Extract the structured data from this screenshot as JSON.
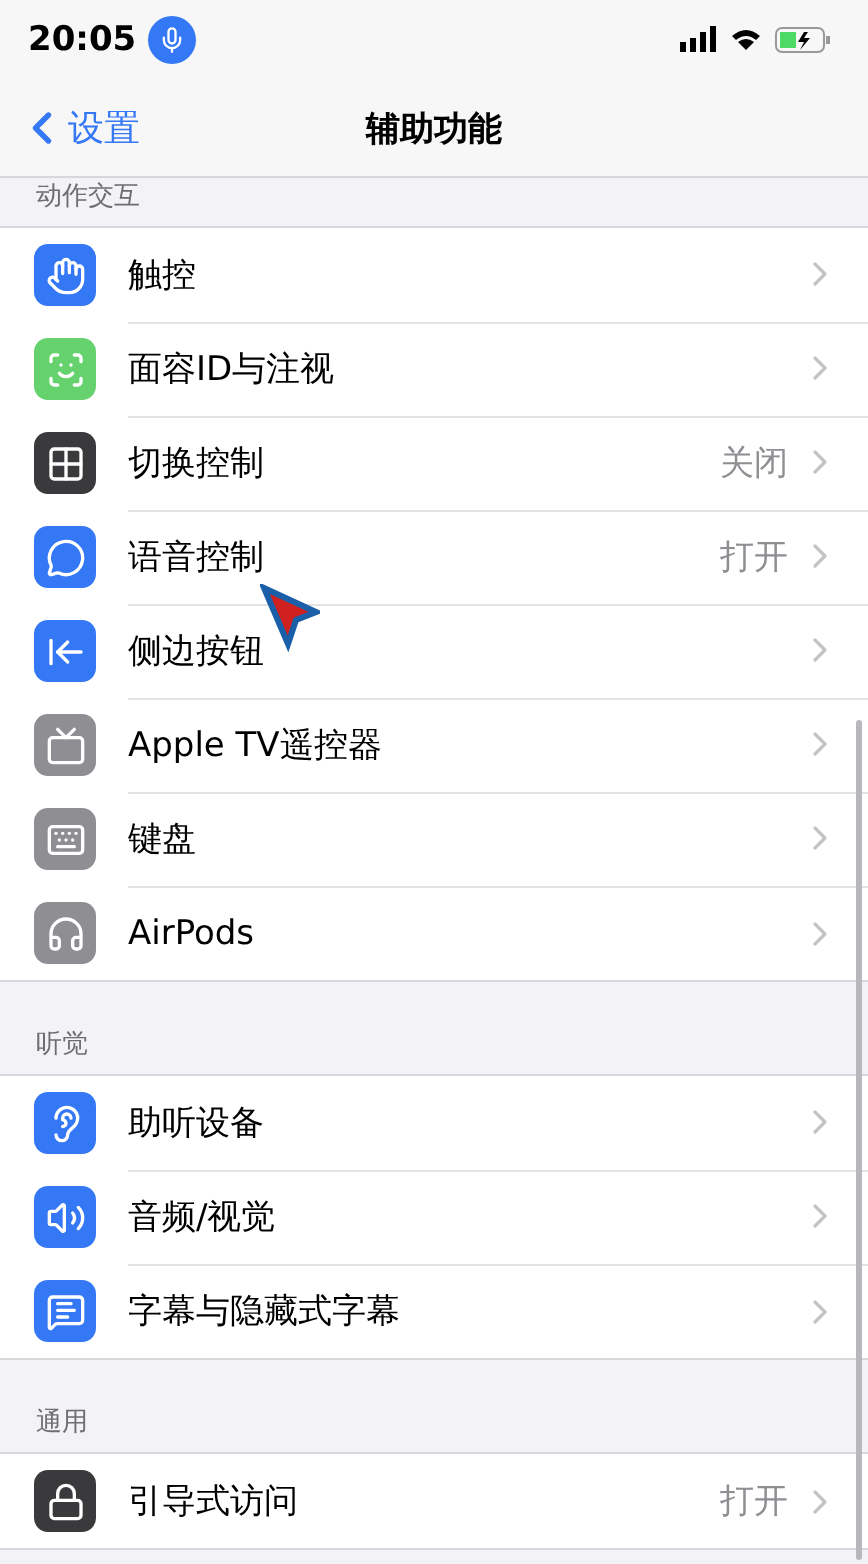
{
  "status_bar": {
    "time": "20:05"
  },
  "nav": {
    "back": "设置",
    "title": "辅助功能"
  },
  "sections": [
    {
      "header": "动作交互",
      "items": [
        {
          "label": "触控",
          "color": "#3478f6"
        },
        {
          "label": "面容ID与注视",
          "color": "#65d26e"
        },
        {
          "label": "切换控制",
          "value": "关闭",
          "color": "#3a3a3c"
        },
        {
          "label": "语音控制",
          "value": "打开",
          "color": "#3478f6"
        },
        {
          "label": "侧边按钮",
          "color": "#3478f6"
        },
        {
          "label": "Apple TV遥控器",
          "color": "#8e8e93"
        },
        {
          "label": "键盘",
          "color": "#8e8e93"
        },
        {
          "label": "AirPods",
          "color": "#8e8e93"
        }
      ]
    },
    {
      "header": "听觉",
      "items": [
        {
          "label": "助听设备",
          "color": "#3478f6"
        },
        {
          "label": "音频/视觉",
          "color": "#3478f6"
        },
        {
          "label": "字幕与隐藏式字幕",
          "color": "#3478f6"
        }
      ]
    },
    {
      "header": "通用",
      "items": [
        {
          "label": "引导式访问",
          "value": "打开",
          "color": "#3a3a3c"
        }
      ]
    }
  ]
}
